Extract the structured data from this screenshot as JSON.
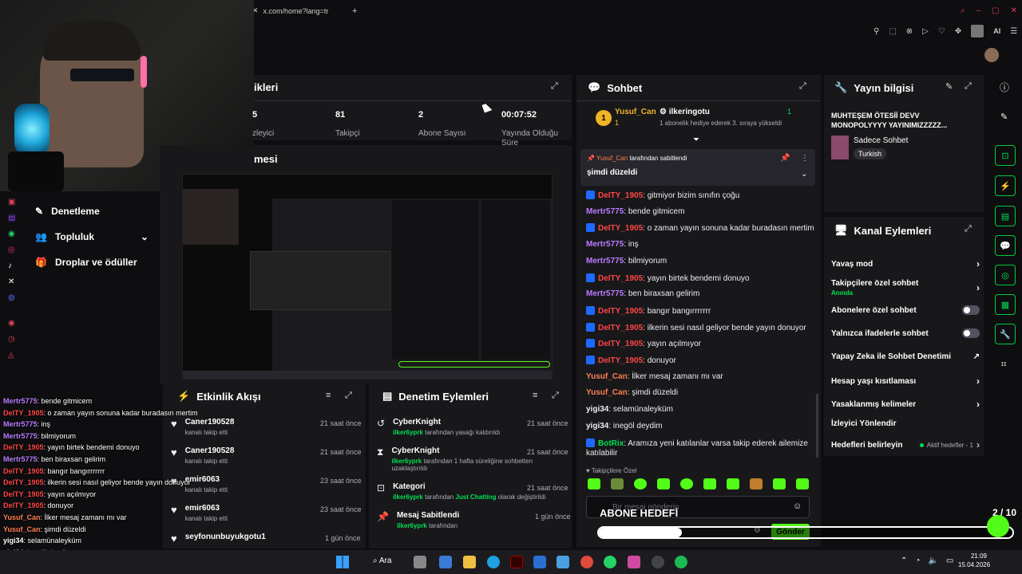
{
  "browser": {
    "tab_title": "x.com/home?lang=tr",
    "tab_add": "+",
    "ext_label": "AI"
  },
  "left_sidebar": {
    "items": [
      {
        "label": "Denetleme"
      },
      {
        "label": "Topluluk"
      },
      {
        "label": "Droplar ve ödüller"
      }
    ]
  },
  "stats_panel": {
    "title": "İzleyiciler ikleri",
    "title_visible": "ikleri",
    "stats": [
      {
        "value": "5",
        "label": "zleyici"
      },
      {
        "value": "81",
        "label": "Takipçi"
      },
      {
        "value": "2",
        "label": "Abone Sayısı"
      },
      {
        "value": "00:07:52",
        "label": "Yayında Olduğu Süre"
      }
    ]
  },
  "preview_panel": {
    "title": "mesi"
  },
  "activity": {
    "title": "Etkinlik Akışı",
    "items": [
      {
        "name": "Caner190528",
        "desc": "kanalı takip etti",
        "time": "21 saat önce"
      },
      {
        "name": "Caner190528",
        "desc": "kanalı takip etti",
        "time": "21 saat önce"
      },
      {
        "name": "emir6063",
        "desc": "kanalı takip etti",
        "time": "23 saat önce"
      },
      {
        "name": "emir6063",
        "desc": "kanalı takip etti",
        "time": "23 saat önce"
      },
      {
        "name": "seyfonunbuyukgotu1",
        "desc": "",
        "time": "1 gün önce"
      }
    ]
  },
  "moderation": {
    "title": "Denetim Eylemleri",
    "items": [
      {
        "title": "CyberKnight",
        "actor": "ilker6yprk",
        "desc": "tarafından yasağı kaldırıldı",
        "time": "21 saat önce"
      },
      {
        "title": "CyberKnight",
        "actor": "ilker6yprk",
        "desc": "tarafından 1 hafta süreliğine sohbetten uzaklaştırıldı",
        "time": "21 saat önce"
      },
      {
        "title": "Kategori",
        "actor": "ilker6yprk",
        "desc_mid": "tarafından",
        "highlight": "Just Chatting",
        "desc": "olarak değiştirildi",
        "time": "21 saat önce"
      },
      {
        "title": "Mesaj Sabitlendi",
        "actor": "ilker6yprk",
        "desc": "tarafından",
        "time": "1 gün önce"
      }
    ]
  },
  "chat": {
    "title": "Sohbet",
    "top_gifter": {
      "name": "Yusuf_Can",
      "count": "1",
      "other_name": "ilkeringotu",
      "other_count": "1",
      "gift_text": "1 abonelik hediye ederek 3. sıraya yükseldi"
    },
    "pinned": {
      "by": "Yusuf_Can",
      "by_text": "tarafından sabitlendi",
      "message": "şimdi düzeldi"
    },
    "messages": [
      {
        "user": "DeITY_1905",
        "text": ": gitmiyor bizim sınıfın çoğu",
        "color": "red",
        "badge": true
      },
      {
        "user": "Mertr5775",
        "text": ": bende gitmicem",
        "color": "purple",
        "badge": false
      },
      {
        "user": "DeITY_1905",
        "text": ": o zaman yayın sonuna kadar buradasın mertim",
        "color": "red",
        "badge": true
      },
      {
        "user": "Mertr5775",
        "text": ": inş",
        "color": "purple",
        "badge": false
      },
      {
        "user": "Mertr5775",
        "text": ": bilmiyorum",
        "color": "purple",
        "badge": false
      },
      {
        "user": "DeITY_1905",
        "text": ": yayın birtek bendemi donuyo",
        "color": "red",
        "badge": true
      },
      {
        "user": "Mertr5775",
        "text": ": ben biraxsan gelirim",
        "color": "purple",
        "badge": false
      },
      {
        "user": "DeITY_1905",
        "text": ": bangır bangırrrrrrr",
        "color": "red",
        "badge": true
      },
      {
        "user": "DeITY_1905",
        "text": ": ilkerin sesi nasıl geliyor bende yayın donuyor",
        "color": "red",
        "badge": true
      },
      {
        "user": "DeITY_1905",
        "text": ": yayın açılmıyor",
        "color": "red",
        "badge": true
      },
      {
        "user": "DeITY_1905",
        "text": ": donuyor",
        "color": "red",
        "badge": true
      },
      {
        "user": "Yusuf_Can",
        "text": ": İlker mesaj zamanı mı var",
        "color": "orange",
        "badge": false
      },
      {
        "user": "Yusuf_Can",
        "text": ": şimdi düzeldi",
        "color": "orange",
        "badge": false
      },
      {
        "user": "yigi34",
        "text": ": selamünaleyküm",
        "color": "plain",
        "badge": false
      },
      {
        "user": "yigi34",
        "text": ": inegöl deydim",
        "color": "plain",
        "badge": false
      },
      {
        "user": "BotRix",
        "text": ": Aramıza yeni katılanlar varsa takip ederek ailemize",
        "color": "green",
        "badge": true
      },
      {
        "user": "",
        "text": "katılabilir",
        "color": "plain",
        "badge": false
      }
    ],
    "followers_only_label": "Takipçilere Özel",
    "input_placeholder": "Bir mesaj gönderin",
    "send_label": "Gönder"
  },
  "stream_info": {
    "title": "Yayın bilgisi",
    "stream_title": "MUHTEŞEM ÖTESİİ DEVV MONOPOLYYYY YAYINIMIZZZZZ...",
    "category": "Sadece Sohbet",
    "language": "Turkish"
  },
  "channel_actions": {
    "title": "Kanal Eylemleri",
    "items": [
      {
        "label": "Yavaş mod",
        "control": "arrow",
        "sub": ""
      },
      {
        "label": "Takipçilere özel sohbet",
        "control": "arrow",
        "sub": "Anında"
      },
      {
        "label": "Abonelere özel sohbet",
        "control": "toggle",
        "sub": ""
      },
      {
        "label": "Yalnızca ifadelerle sohbet",
        "control": "toggle",
        "sub": ""
      },
      {
        "label": "Yapay Zeka ile Sohbet Denetimi",
        "control": "external",
        "sub": ""
      },
      {
        "label": "Hesap yaşı kısıtlaması",
        "control": "arrow",
        "sub": ""
      },
      {
        "label": "Yasaklanmış kelimeler",
        "control": "arrow",
        "sub": ""
      },
      {
        "label": "İzleyici Yönlendir",
        "control": "none",
        "sub": ""
      },
      {
        "label": "Hedefleri belirleyin",
        "control": "arrow",
        "sub": "Aktif hedefler - 1"
      }
    ]
  },
  "overlay": {
    "goal_label": "ABONE HEDEFİ",
    "goal_count": "2 / 10",
    "goal_progress": 0.2,
    "chat_lines": [
      {
        "user": "Mertr5775",
        "text": ": bende gitmicem"
      },
      {
        "user": "DeITY_1905",
        "text": ": o zaman yayın sonuna kadar buradasın mertim"
      },
      {
        "user": "Mertr5775",
        "text": ": inş"
      },
      {
        "user": "Mertr5775",
        "text": ": bilmiyorum"
      },
      {
        "user": "DeITY_1905",
        "text": ": yayın birtek bendemi donuyo"
      },
      {
        "user": "Mertr5775",
        "text": ": ben biraxsan gelirim"
      },
      {
        "user": "DeITY_1905",
        "text": ": bangır bangırrrrrrr"
      },
      {
        "user": "DeITY_1905",
        "text": ": ilkerin sesi nasıl geliyor bende yayın donuyor"
      },
      {
        "user": "DeITY_1905",
        "text": ": yayın açılmıyor"
      },
      {
        "user": "DeITY_1905",
        "text": ": donuyor"
      },
      {
        "user": "Yusuf_Can",
        "text": ": İlker mesaj zamanı mı var"
      },
      {
        "user": "Yusuf_Can",
        "text": ": şimdi düzeldi"
      },
      {
        "user": "yigi34",
        "text": ": selamünaleyküm"
      },
      {
        "user": "yigi34",
        "text": ": inegöl deydim"
      }
    ]
  },
  "taskbar": {
    "search_label": "Ara",
    "time": "21:09",
    "date": "15.04.2026"
  },
  "colors": {
    "kick_green": "#53fc18",
    "panel_bg": "#18181b",
    "page_bg": "#0e0e10"
  }
}
